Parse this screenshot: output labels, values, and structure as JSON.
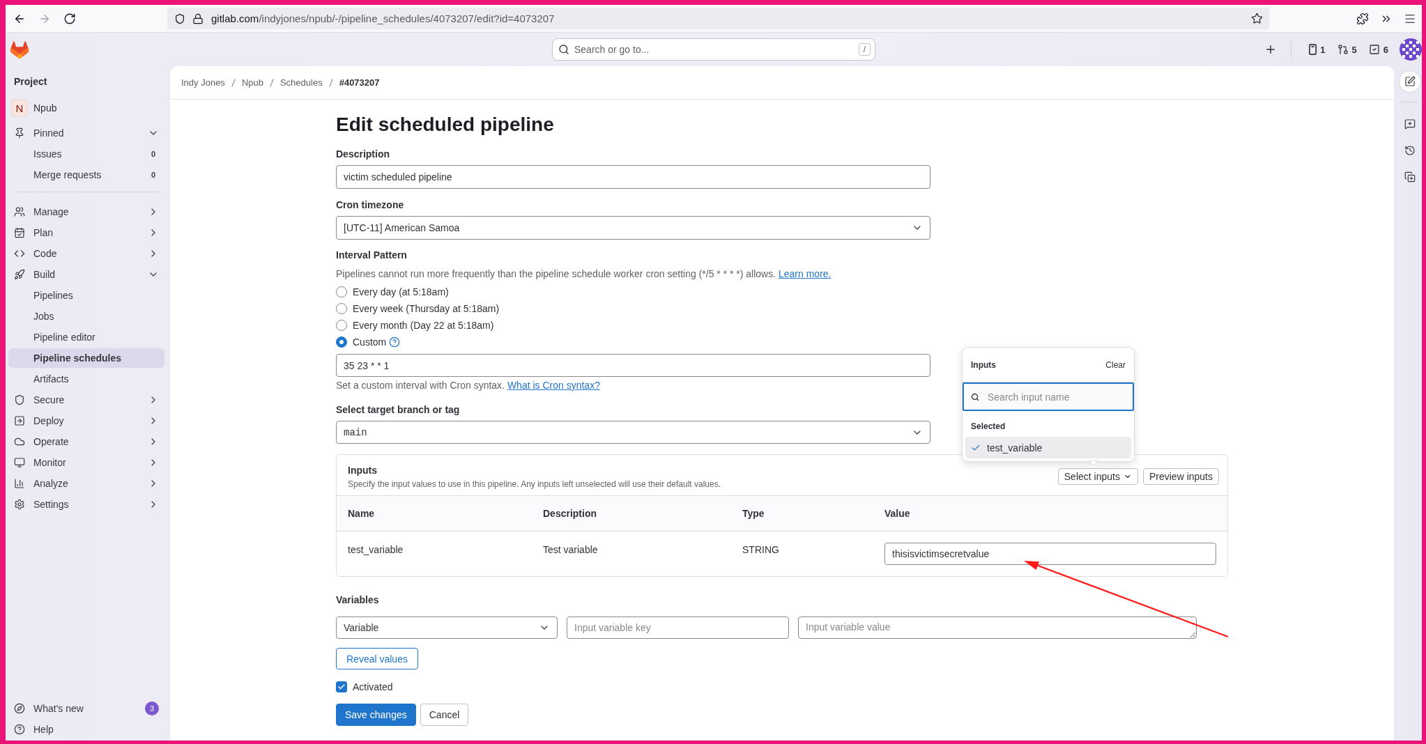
{
  "browser": {
    "url_host": "gitlab.com",
    "url_path": "/indyjones/npub/-/pipeline_schedules/4073207/edit?id=4073207"
  },
  "top_bar": {
    "search_placeholder": "Search or go to...",
    "search_shortcut": "/",
    "counters": [
      {
        "kind": "issues",
        "count": "1"
      },
      {
        "kind": "merge_requests",
        "count": "5"
      },
      {
        "kind": "todos",
        "count": "6"
      }
    ]
  },
  "sidebar": {
    "heading": "Project",
    "project": {
      "initial": "N",
      "name": "Npub"
    },
    "items": [
      {
        "kind": "pinned",
        "label": "Pinned",
        "expanded": true,
        "selected": false,
        "children": [
          {
            "label": "Issues",
            "count": "0",
            "selected": false
          },
          {
            "label": "Merge requests",
            "count": "0",
            "selected": false
          }
        ]
      },
      {
        "kind": "manage",
        "label": "Manage",
        "expanded": false,
        "selected": false
      },
      {
        "kind": "plan",
        "label": "Plan",
        "expanded": false,
        "selected": false
      },
      {
        "kind": "code",
        "label": "Code",
        "expanded": false,
        "selected": false
      },
      {
        "kind": "build",
        "label": "Build",
        "expanded": true,
        "selected": false,
        "children": [
          {
            "label": "Pipelines",
            "selected": false
          },
          {
            "label": "Jobs",
            "selected": false
          },
          {
            "label": "Pipeline editor",
            "selected": false
          },
          {
            "label": "Pipeline schedules",
            "selected": true
          },
          {
            "label": "Artifacts",
            "selected": false
          }
        ]
      },
      {
        "kind": "secure",
        "label": "Secure",
        "expanded": false,
        "selected": false
      },
      {
        "kind": "deploy",
        "label": "Deploy",
        "expanded": false,
        "selected": false
      },
      {
        "kind": "operate",
        "label": "Operate",
        "expanded": false,
        "selected": false
      },
      {
        "kind": "monitor",
        "label": "Monitor",
        "expanded": false,
        "selected": false
      },
      {
        "kind": "analyze",
        "label": "Analyze",
        "expanded": false,
        "selected": false
      },
      {
        "kind": "settings",
        "label": "Settings",
        "expanded": false,
        "selected": false
      }
    ],
    "footer": [
      {
        "kind": "whats_new",
        "label": "What's new",
        "badge": "3"
      },
      {
        "kind": "help",
        "label": "Help"
      }
    ]
  },
  "breadcrumbs": [
    {
      "label": "Indy Jones",
      "current": false
    },
    {
      "label": "Npub",
      "current": false
    },
    {
      "label": "Schedules",
      "current": false
    },
    {
      "label": "#4073207",
      "current": true
    }
  ],
  "form": {
    "title": "Edit scheduled pipeline",
    "description": {
      "label": "Description",
      "value": "victim scheduled pipeline"
    },
    "timezone": {
      "label": "Cron timezone",
      "value": "[UTC-11] American Samoa"
    },
    "interval": {
      "label": "Interval Pattern",
      "help": "Pipelines cannot run more frequently than the pipeline schedule worker cron setting (*/5 * * * *) allows.",
      "help_link": "Learn more.",
      "options": [
        {
          "kind": "preset",
          "label": "Every day (at 5:18am)",
          "selected": false
        },
        {
          "kind": "preset",
          "label": "Every week (Thursday at 5:18am)",
          "selected": false
        },
        {
          "kind": "preset",
          "label": "Every month (Day 22 at 5:18am)",
          "selected": false
        },
        {
          "kind": "custom",
          "label": "Custom",
          "selected": true
        }
      ],
      "cron_value": "35 23 * * 1",
      "cron_help": "Set a custom interval with Cron syntax.",
      "cron_help_link": "What is Cron syntax?"
    },
    "target": {
      "label": "Select target branch or tag",
      "value": "main"
    },
    "inputs": {
      "title": "Inputs",
      "help": "Specify the input values to use in this pipeline. Any inputs left unselected will use their default values.",
      "buttons": [
        {
          "kind": "dropdown",
          "label": "Select inputs"
        },
        {
          "kind": "plain",
          "label": "Preview inputs"
        }
      ],
      "columns": [
        "Name",
        "Description",
        "Type",
        "Value"
      ],
      "rows": [
        {
          "name": "test_variable",
          "description": "Test variable",
          "type": "STRING",
          "value": "thisisvictimsecretvalue"
        }
      ],
      "dropdown": {
        "title": "Inputs",
        "clear": "Clear",
        "search_placeholder": "Search input name",
        "focused": true,
        "section": "Selected",
        "items": [
          {
            "label": "test_variable",
            "checked": true
          }
        ]
      }
    },
    "variables": {
      "label": "Variables",
      "rows": [
        {
          "type": "Variable",
          "key_placeholder": "Input variable key",
          "value_placeholder": "Input variable value"
        }
      ],
      "reveal_button": "Reveal values"
    },
    "activated": {
      "label": "Activated",
      "checked": true
    },
    "actions": [
      {
        "kind": "primary",
        "label": "Save changes"
      },
      {
        "kind": "secondary",
        "label": "Cancel"
      }
    ]
  }
}
